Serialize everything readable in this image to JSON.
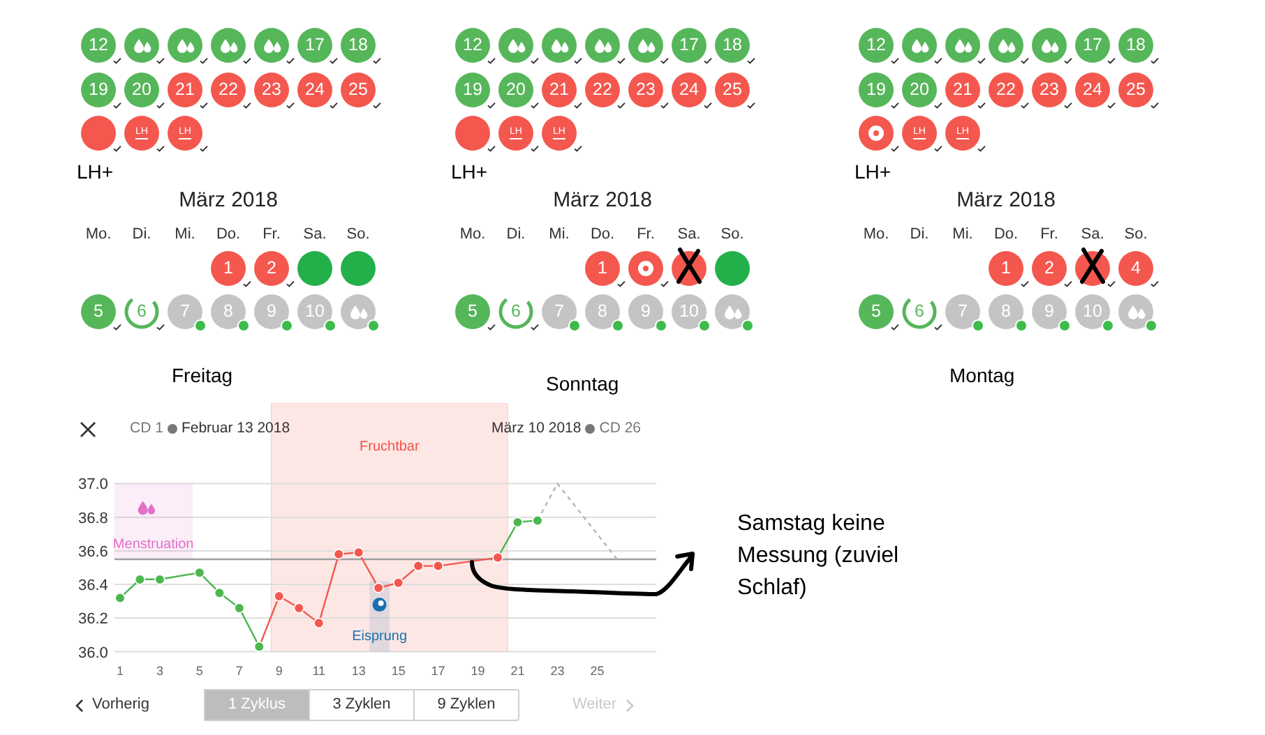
{
  "calendars": [
    {
      "cycle_days": [
        {
          "text": "12",
          "kind": "number",
          "color": "#56b65a",
          "checked": true,
          "pending": false,
          "crossed": false
        },
        {
          "kind": "drops",
          "color": "#56b65a",
          "checked": true,
          "pending": false,
          "crossed": false
        },
        {
          "kind": "drops",
          "color": "#56b65a",
          "checked": true,
          "pending": false,
          "crossed": false
        },
        {
          "kind": "drops",
          "color": "#56b65a",
          "checked": true,
          "pending": false,
          "crossed": false
        },
        {
          "kind": "drops",
          "color": "#56b65a",
          "checked": true,
          "pending": false,
          "crossed": false
        },
        {
          "text": "17",
          "kind": "number",
          "color": "#56b65a",
          "checked": true,
          "pending": false,
          "crossed": false
        },
        {
          "text": "18",
          "kind": "number",
          "color": "#56b65a",
          "checked": true,
          "pending": false,
          "crossed": false
        },
        {
          "text": "19",
          "kind": "number",
          "color": "#56b65a",
          "checked": true,
          "pending": false,
          "crossed": false
        },
        {
          "text": "20",
          "kind": "number",
          "color": "#56b65a",
          "checked": true,
          "pending": false,
          "crossed": false
        },
        {
          "text": "21",
          "kind": "number",
          "color": "#f4574e",
          "checked": true,
          "pending": false,
          "crossed": false
        },
        {
          "text": "22",
          "kind": "number",
          "color": "#f4574e",
          "checked": true,
          "pending": false,
          "crossed": false
        },
        {
          "text": "23",
          "kind": "number",
          "color": "#f4574e",
          "checked": true,
          "pending": false,
          "crossed": false
        },
        {
          "text": "24",
          "kind": "number",
          "color": "#f4574e",
          "checked": true,
          "pending": false,
          "crossed": false
        },
        {
          "text": "25",
          "kind": "number",
          "color": "#f4574e",
          "checked": true,
          "pending": false,
          "crossed": false
        },
        {
          "kind": "blank",
          "color": "#f4574e",
          "checked": true,
          "pending": false,
          "crossed": false
        },
        {
          "text": "LH",
          "kind": "lh",
          "color": "#f4574e",
          "checked": true,
          "pending": false,
          "crossed": false
        },
        {
          "text": "LH",
          "kind": "lh",
          "color": "#f4574e",
          "checked": true,
          "pending": false,
          "crossed": false
        }
      ],
      "lh_label": "LH+",
      "month": "März 2018",
      "weekdays": [
        "Mo.",
        "Di.",
        "Mi.",
        "Do.",
        "Fr.",
        "Sa.",
        "So."
      ],
      "weeks": [
        [
          {
            "text": "1",
            "kind": "number",
            "color": "#f4574e",
            "checked": true,
            "pending": false,
            "crossed": false
          },
          {
            "text": "2",
            "kind": "number",
            "color": "#f4574e",
            "checked": true,
            "pending": false,
            "crossed": false
          },
          {
            "kind": "blank",
            "color": "#23b04b",
            "checked": false,
            "pending": false,
            "crossed": false
          },
          {
            "kind": "blank",
            "color": "#23b04b",
            "checked": false,
            "pending": false,
            "crossed": false
          }
        ],
        [
          {
            "text": "5",
            "kind": "number",
            "color": "#56b65a",
            "checked": true,
            "pending": false,
            "crossed": false
          },
          {
            "text": "6",
            "kind": "ring",
            "color": "#56b65a",
            "checked": true,
            "pending": false,
            "crossed": false
          },
          {
            "text": "7",
            "kind": "number",
            "color": "#c4c4c4",
            "checked": false,
            "pending": true,
            "crossed": false
          },
          {
            "text": "8",
            "kind": "number",
            "color": "#c4c4c4",
            "checked": false,
            "pending": true,
            "crossed": false
          },
          {
            "text": "9",
            "kind": "number",
            "color": "#c4c4c4",
            "checked": false,
            "pending": true,
            "crossed": false
          },
          {
            "text": "10",
            "kind": "number",
            "color": "#c4c4c4",
            "checked": false,
            "pending": true,
            "crossed": false
          },
          {
            "kind": "drops",
            "color": "#c4c4c4",
            "checked": false,
            "pending": true,
            "crossed": false
          }
        ]
      ],
      "caption": "Freitag"
    },
    {
      "cycle_days": [
        {
          "text": "12",
          "kind": "number",
          "color": "#56b65a",
          "checked": true,
          "pending": false,
          "crossed": false
        },
        {
          "kind": "drops",
          "color": "#56b65a",
          "checked": true,
          "pending": false,
          "crossed": false
        },
        {
          "kind": "drops",
          "color": "#56b65a",
          "checked": true,
          "pending": false,
          "crossed": false
        },
        {
          "kind": "drops",
          "color": "#56b65a",
          "checked": true,
          "pending": false,
          "crossed": false
        },
        {
          "kind": "drops",
          "color": "#56b65a",
          "checked": true,
          "pending": false,
          "crossed": false
        },
        {
          "text": "17",
          "kind": "number",
          "color": "#56b65a",
          "checked": true,
          "pending": false,
          "crossed": false
        },
        {
          "text": "18",
          "kind": "number",
          "color": "#56b65a",
          "checked": true,
          "pending": false,
          "crossed": false
        },
        {
          "text": "19",
          "kind": "number",
          "color": "#56b65a",
          "checked": true,
          "pending": false,
          "crossed": false
        },
        {
          "text": "20",
          "kind": "number",
          "color": "#56b65a",
          "checked": true,
          "pending": false,
          "crossed": false
        },
        {
          "text": "21",
          "kind": "number",
          "color": "#f4574e",
          "checked": true,
          "pending": false,
          "crossed": false
        },
        {
          "text": "22",
          "kind": "number",
          "color": "#f4574e",
          "checked": true,
          "pending": false,
          "crossed": false
        },
        {
          "text": "23",
          "kind": "number",
          "color": "#f4574e",
          "checked": true,
          "pending": false,
          "crossed": false
        },
        {
          "text": "24",
          "kind": "number",
          "color": "#f4574e",
          "checked": true,
          "pending": false,
          "crossed": false
        },
        {
          "text": "25",
          "kind": "number",
          "color": "#f4574e",
          "checked": true,
          "pending": false,
          "crossed": false
        },
        {
          "kind": "blank",
          "color": "#f4574e",
          "checked": true,
          "pending": false,
          "crossed": false
        },
        {
          "text": "LH",
          "kind": "lh",
          "color": "#f4574e",
          "checked": true,
          "pending": false,
          "crossed": false
        },
        {
          "text": "LH",
          "kind": "lh",
          "color": "#f4574e",
          "checked": true,
          "pending": false,
          "crossed": false
        }
      ],
      "lh_label": "LH+",
      "month": "März 2018",
      "weekdays": [
        "Mo.",
        "Di.",
        "Mi.",
        "Do.",
        "Fr.",
        "Sa.",
        "So."
      ],
      "weeks": [
        [
          {
            "text": "1",
            "kind": "number",
            "color": "#f4574e",
            "checked": true,
            "pending": false,
            "crossed": false
          },
          {
            "kind": "ovulation",
            "color": "#f4574e",
            "checked": true,
            "pending": false,
            "crossed": false
          },
          {
            "kind": "blank",
            "color": "#f4574e",
            "checked": false,
            "pending": false,
            "crossed": true
          },
          {
            "kind": "blank",
            "color": "#23b04b",
            "checked": false,
            "pending": false,
            "crossed": false
          }
        ],
        [
          {
            "text": "5",
            "kind": "number",
            "color": "#56b65a",
            "checked": true,
            "pending": false,
            "crossed": false
          },
          {
            "text": "6",
            "kind": "ring",
            "color": "#56b65a",
            "checked": true,
            "pending": false,
            "crossed": false
          },
          {
            "text": "7",
            "kind": "number",
            "color": "#c4c4c4",
            "checked": false,
            "pending": true,
            "crossed": false
          },
          {
            "text": "8",
            "kind": "number",
            "color": "#c4c4c4",
            "checked": false,
            "pending": true,
            "crossed": false
          },
          {
            "text": "9",
            "kind": "number",
            "color": "#c4c4c4",
            "checked": false,
            "pending": true,
            "crossed": false
          },
          {
            "text": "10",
            "kind": "number",
            "color": "#c4c4c4",
            "checked": false,
            "pending": true,
            "crossed": false
          },
          {
            "kind": "drops",
            "color": "#c4c4c4",
            "checked": false,
            "pending": true,
            "crossed": false
          }
        ]
      ],
      "caption": "Sonntag"
    },
    {
      "cycle_days": [
        {
          "text": "12",
          "kind": "number",
          "color": "#56b65a",
          "checked": true,
          "pending": false,
          "crossed": false
        },
        {
          "kind": "drops",
          "color": "#56b65a",
          "checked": true,
          "pending": false,
          "crossed": false
        },
        {
          "kind": "drops",
          "color": "#56b65a",
          "checked": true,
          "pending": false,
          "crossed": false
        },
        {
          "kind": "drops",
          "color": "#56b65a",
          "checked": true,
          "pending": false,
          "crossed": false
        },
        {
          "kind": "drops",
          "color": "#56b65a",
          "checked": true,
          "pending": false,
          "crossed": false
        },
        {
          "text": "17",
          "kind": "number",
          "color": "#56b65a",
          "checked": true,
          "pending": false,
          "crossed": false
        },
        {
          "text": "18",
          "kind": "number",
          "color": "#56b65a",
          "checked": true,
          "pending": false,
          "crossed": false
        },
        {
          "text": "19",
          "kind": "number",
          "color": "#56b65a",
          "checked": true,
          "pending": false,
          "crossed": false
        },
        {
          "text": "20",
          "kind": "number",
          "color": "#56b65a",
          "checked": true,
          "pending": false,
          "crossed": false
        },
        {
          "text": "21",
          "kind": "number",
          "color": "#f4574e",
          "checked": true,
          "pending": false,
          "crossed": false
        },
        {
          "text": "22",
          "kind": "number",
          "color": "#f4574e",
          "checked": true,
          "pending": false,
          "crossed": false
        },
        {
          "text": "23",
          "kind": "number",
          "color": "#f4574e",
          "checked": true,
          "pending": false,
          "crossed": false
        },
        {
          "text": "24",
          "kind": "number",
          "color": "#f4574e",
          "checked": true,
          "pending": false,
          "crossed": false
        },
        {
          "text": "25",
          "kind": "number",
          "color": "#f4574e",
          "checked": true,
          "pending": false,
          "crossed": false
        },
        {
          "kind": "ovulation",
          "color": "#f4574e",
          "checked": true,
          "pending": false,
          "crossed": false
        },
        {
          "text": "LH",
          "kind": "lh",
          "color": "#f4574e",
          "checked": true,
          "pending": false,
          "crossed": false
        },
        {
          "text": "LH",
          "kind": "lh",
          "color": "#f4574e",
          "checked": true,
          "pending": false,
          "crossed": false
        }
      ],
      "lh_label": "LH+",
      "month": "März 2018",
      "weekdays": [
        "Mo.",
        "Di.",
        "Mi.",
        "Do.",
        "Fr.",
        "Sa.",
        "So."
      ],
      "weeks": [
        [
          {
            "text": "1",
            "kind": "number",
            "color": "#f4574e",
            "checked": true,
            "pending": false,
            "crossed": false
          },
          {
            "text": "2",
            "kind": "number",
            "color": "#f4574e",
            "checked": true,
            "pending": false,
            "crossed": false
          },
          {
            "kind": "blank",
            "color": "#f4574e",
            "checked": true,
            "pending": false,
            "crossed": true
          },
          {
            "text": "4",
            "kind": "number",
            "color": "#f4574e",
            "checked": true,
            "pending": false,
            "crossed": false
          }
        ],
        [
          {
            "text": "5",
            "kind": "number",
            "color": "#56b65a",
            "checked": true,
            "pending": false,
            "crossed": false
          },
          {
            "text": "6",
            "kind": "ring",
            "color": "#56b65a",
            "checked": true,
            "pending": false,
            "crossed": false
          },
          {
            "text": "7",
            "kind": "number",
            "color": "#c4c4c4",
            "checked": false,
            "pending": true,
            "crossed": false
          },
          {
            "text": "8",
            "kind": "number",
            "color": "#c4c4c4",
            "checked": false,
            "pending": true,
            "crossed": false
          },
          {
            "text": "9",
            "kind": "number",
            "color": "#c4c4c4",
            "checked": false,
            "pending": true,
            "crossed": false
          },
          {
            "text": "10",
            "kind": "number",
            "color": "#c4c4c4",
            "checked": false,
            "pending": true,
            "crossed": false
          },
          {
            "kind": "drops",
            "color": "#c4c4c4",
            "checked": false,
            "pending": true,
            "crossed": false
          }
        ]
      ],
      "caption": "Montag"
    }
  ],
  "chart_panel": {
    "header": {
      "start_cd": "CD 1",
      "start_date": "Februar 13 2018",
      "end_date": "März 10 2018",
      "end_cd": "CD 26"
    },
    "chart_data": {
      "type": "line",
      "x": [
        1,
        2,
        3,
        4,
        5,
        6,
        7,
        8,
        9,
        10,
        11,
        12,
        13,
        14,
        15,
        16,
        17,
        18,
        19,
        20,
        21,
        22,
        23,
        24,
        25,
        26
      ],
      "series": [
        {
          "color": "#4cb64f",
          "line_style": "solid",
          "marker": "o",
          "values": [
            36.32,
            36.43,
            36.43,
            null,
            36.47,
            36.35,
            36.26,
            36.03,
            null,
            null,
            null,
            null,
            null,
            null,
            null,
            null,
            null,
            null,
            null,
            null,
            36.77,
            36.78,
            null,
            null,
            null,
            null
          ]
        },
        {
          "color": "#f4574e",
          "line_style": "solid",
          "marker": "o",
          "values": [
            null,
            null,
            null,
            null,
            null,
            null,
            null,
            null,
            36.33,
            36.26,
            36.17,
            36.58,
            36.59,
            36.38,
            36.41,
            36.51,
            36.51,
            null,
            null,
            36.56,
            null,
            null,
            null,
            null,
            null,
            null
          ]
        },
        {
          "color": "#b5b5b5",
          "line_style": "dashed",
          "marker": "none",
          "values": [
            null,
            null,
            null,
            null,
            null,
            null,
            null,
            null,
            null,
            null,
            null,
            null,
            null,
            null,
            null,
            null,
            null,
            null,
            null,
            null,
            null,
            36.78,
            37.0,
            null,
            null,
            36.55
          ]
        }
      ],
      "xlim": [
        0.72,
        27.97
      ],
      "ylim": [
        36,
        37
      ],
      "xticks": [
        1,
        3,
        5,
        7,
        9,
        11,
        13,
        15,
        17,
        19,
        21,
        23,
        25
      ],
      "yticks": [
        {
          "value": 36,
          "label": "36.0"
        },
        {
          "value": 36.2,
          "label": "36.2"
        },
        {
          "value": 36.4,
          "label": "36.4"
        },
        {
          "value": 36.6,
          "label": "36.6"
        },
        {
          "value": 36.8,
          "label": "36.8"
        },
        {
          "value": 37,
          "label": "37.0"
        }
      ],
      "grid": true,
      "bands": [
        {
          "axis": "x",
          "from": 8.6,
          "to": 20.5,
          "label": "Fruchtbar",
          "color": "#f0524a"
        },
        {
          "axis": "x",
          "from": 0.7,
          "to": 4.65,
          "label": "Menstruation",
          "color": "#e070c8"
        },
        {
          "axis": "x",
          "from": 13.55,
          "to": 14.55,
          "label": "Eisprung",
          "color": "#1a6fb0"
        }
      ],
      "ref_lines": [
        {
          "axis": "y",
          "value": 36.55,
          "color": "#9e9e9e"
        }
      ]
    },
    "previous": {
      "label": "Vorherig",
      "disabled": false
    },
    "ranges": [
      {
        "label": "1 Zyklus",
        "selected": true
      },
      {
        "label": "3 Zyklen",
        "selected": false
      },
      {
        "label": "9 Zyklen",
        "selected": false
      }
    ],
    "next": {
      "label": "Weiter",
      "disabled": true
    }
  },
  "note": "Samstag keine Messung (zuviel Schlaf)"
}
